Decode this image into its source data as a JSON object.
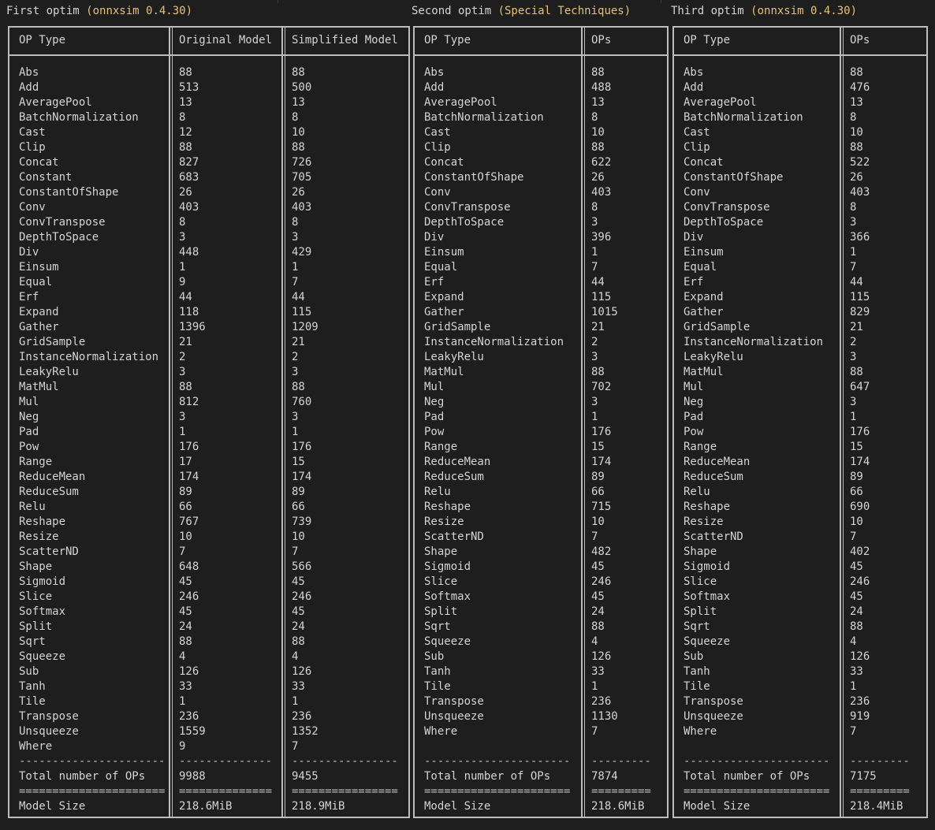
{
  "headers": [
    {
      "label": "First optim ",
      "note": "(onnxsim 0.4.30)"
    },
    {
      "label": "Second optim ",
      "note": "(Special Techniques)"
    },
    {
      "label": "Third optim ",
      "note": "(onnxsim 0.4.30)"
    }
  ],
  "tables": [
    {
      "columns": [
        "OP Type",
        "Original Model",
        "Simplified Model"
      ],
      "rows": [
        [
          "Abs",
          "88",
          "88"
        ],
        [
          "Add",
          "513",
          "500"
        ],
        [
          "AveragePool",
          "13",
          "13"
        ],
        [
          "BatchNormalization",
          "8",
          "8"
        ],
        [
          "Cast",
          "12",
          "10"
        ],
        [
          "Clip",
          "88",
          "88"
        ],
        [
          "Concat",
          "827",
          "726"
        ],
        [
          "Constant",
          "683",
          "705"
        ],
        [
          "ConstantOfShape",
          "26",
          "26"
        ],
        [
          "Conv",
          "403",
          "403"
        ],
        [
          "ConvTranspose",
          "8",
          "8"
        ],
        [
          "DepthToSpace",
          "3",
          "3"
        ],
        [
          "Div",
          "448",
          "429"
        ],
        [
          "Einsum",
          "1",
          "1"
        ],
        [
          "Equal",
          "9",
          "7"
        ],
        [
          "Erf",
          "44",
          "44"
        ],
        [
          "Expand",
          "118",
          "115"
        ],
        [
          "Gather",
          "1396",
          "1209"
        ],
        [
          "GridSample",
          "21",
          "21"
        ],
        [
          "InstanceNormalization",
          "2",
          "2"
        ],
        [
          "LeakyRelu",
          "3",
          "3"
        ],
        [
          "MatMul",
          "88",
          "88"
        ],
        [
          "Mul",
          "812",
          "760"
        ],
        [
          "Neg",
          "3",
          "3"
        ],
        [
          "Pad",
          "1",
          "1"
        ],
        [
          "Pow",
          "176",
          "176"
        ],
        [
          "Range",
          "17",
          "15"
        ],
        [
          "ReduceMean",
          "174",
          "174"
        ],
        [
          "ReduceSum",
          "89",
          "89"
        ],
        [
          "Relu",
          "66",
          "66"
        ],
        [
          "Reshape",
          "767",
          "739"
        ],
        [
          "Resize",
          "10",
          "10"
        ],
        [
          "ScatterND",
          "7",
          "7"
        ],
        [
          "Shape",
          "648",
          "566"
        ],
        [
          "Sigmoid",
          "45",
          "45"
        ],
        [
          "Slice",
          "246",
          "246"
        ],
        [
          "Softmax",
          "45",
          "45"
        ],
        [
          "Split",
          "24",
          "24"
        ],
        [
          "Sqrt",
          "88",
          "88"
        ],
        [
          "Squeeze",
          "4",
          "4"
        ],
        [
          "Sub",
          "126",
          "126"
        ],
        [
          "Tanh",
          "33",
          "33"
        ],
        [
          "Tile",
          "1",
          "1"
        ],
        [
          "Transpose",
          "236",
          "236"
        ],
        [
          "Unsqueeze",
          "1559",
          "1352"
        ],
        [
          "Where",
          "9",
          "7"
        ]
      ],
      "dashes": [
        "----------------------",
        "--------------",
        "----------------"
      ],
      "total": [
        "Total number of OPs",
        "9988",
        "9455"
      ],
      "eq": [
        "======================",
        "==============",
        "================"
      ],
      "size": [
        "Model Size",
        "218.6MiB",
        "218.9MiB"
      ]
    },
    {
      "columns": [
        "OP Type",
        "OPs"
      ],
      "rows": [
        [
          "Abs",
          "88"
        ],
        [
          "Add",
          "488"
        ],
        [
          "AveragePool",
          "13"
        ],
        [
          "BatchNormalization",
          "8"
        ],
        [
          "Cast",
          "10"
        ],
        [
          "Clip",
          "88"
        ],
        [
          "Concat",
          "622"
        ],
        [
          "ConstantOfShape",
          "26"
        ],
        [
          "Conv",
          "403"
        ],
        [
          "ConvTranspose",
          "8"
        ],
        [
          "DepthToSpace",
          "3"
        ],
        [
          "Div",
          "396"
        ],
        [
          "Einsum",
          "1"
        ],
        [
          "Equal",
          "7"
        ],
        [
          "Erf",
          "44"
        ],
        [
          "Expand",
          "115"
        ],
        [
          "Gather",
          "1015"
        ],
        [
          "GridSample",
          "21"
        ],
        [
          "InstanceNormalization",
          "2"
        ],
        [
          "LeakyRelu",
          "3"
        ],
        [
          "MatMul",
          "88"
        ],
        [
          "Mul",
          "702"
        ],
        [
          "Neg",
          "3"
        ],
        [
          "Pad",
          "1"
        ],
        [
          "Pow",
          "176"
        ],
        [
          "Range",
          "15"
        ],
        [
          "ReduceMean",
          "174"
        ],
        [
          "ReduceSum",
          "89"
        ],
        [
          "Relu",
          "66"
        ],
        [
          "Reshape",
          "715"
        ],
        [
          "Resize",
          "10"
        ],
        [
          "ScatterND",
          "7"
        ],
        [
          "Shape",
          "482"
        ],
        [
          "Sigmoid",
          "45"
        ],
        [
          "Slice",
          "246"
        ],
        [
          "Softmax",
          "45"
        ],
        [
          "Split",
          "24"
        ],
        [
          "Sqrt",
          "88"
        ],
        [
          "Squeeze",
          "4"
        ],
        [
          "Sub",
          "126"
        ],
        [
          "Tanh",
          "33"
        ],
        [
          "Tile",
          "1"
        ],
        [
          "Transpose",
          "236"
        ],
        [
          "Unsqueeze",
          "1130"
        ],
        [
          "Where",
          "7"
        ]
      ],
      "dashes": [
        "----------------------",
        "---------"
      ],
      "total": [
        "Total number of OPs",
        "7874"
      ],
      "eq": [
        "======================",
        "========="
      ],
      "size": [
        "Model Size",
        "218.6MiB"
      ]
    },
    {
      "columns": [
        "OP Type",
        "OPs"
      ],
      "rows": [
        [
          "Abs",
          "88"
        ],
        [
          "Add",
          "476"
        ],
        [
          "AveragePool",
          "13"
        ],
        [
          "BatchNormalization",
          "8"
        ],
        [
          "Cast",
          "10"
        ],
        [
          "Clip",
          "88"
        ],
        [
          "Concat",
          "522"
        ],
        [
          "ConstantOfShape",
          "26"
        ],
        [
          "Conv",
          "403"
        ],
        [
          "ConvTranspose",
          "8"
        ],
        [
          "DepthToSpace",
          "3"
        ],
        [
          "Div",
          "366"
        ],
        [
          "Einsum",
          "1"
        ],
        [
          "Equal",
          "7"
        ],
        [
          "Erf",
          "44"
        ],
        [
          "Expand",
          "115"
        ],
        [
          "Gather",
          "829"
        ],
        [
          "GridSample",
          "21"
        ],
        [
          "InstanceNormalization",
          "2"
        ],
        [
          "LeakyRelu",
          "3"
        ],
        [
          "MatMul",
          "88"
        ],
        [
          "Mul",
          "647"
        ],
        [
          "Neg",
          "3"
        ],
        [
          "Pad",
          "1"
        ],
        [
          "Pow",
          "176"
        ],
        [
          "Range",
          "15"
        ],
        [
          "ReduceMean",
          "174"
        ],
        [
          "ReduceSum",
          "89"
        ],
        [
          "Relu",
          "66"
        ],
        [
          "Reshape",
          "690"
        ],
        [
          "Resize",
          "10"
        ],
        [
          "ScatterND",
          "7"
        ],
        [
          "Shape",
          "402"
        ],
        [
          "Sigmoid",
          "45"
        ],
        [
          "Slice",
          "246"
        ],
        [
          "Softmax",
          "45"
        ],
        [
          "Split",
          "24"
        ],
        [
          "Sqrt",
          "88"
        ],
        [
          "Squeeze",
          "4"
        ],
        [
          "Sub",
          "126"
        ],
        [
          "Tanh",
          "33"
        ],
        [
          "Tile",
          "1"
        ],
        [
          "Transpose",
          "236"
        ],
        [
          "Unsqueeze",
          "919"
        ],
        [
          "Where",
          "7"
        ]
      ],
      "dashes": [
        "----------------------",
        "---------"
      ],
      "total": [
        "Total number of OPs",
        "7175"
      ],
      "eq": [
        "======================",
        "========="
      ],
      "size": [
        "Model Size",
        "218.4MiB"
      ]
    }
  ]
}
